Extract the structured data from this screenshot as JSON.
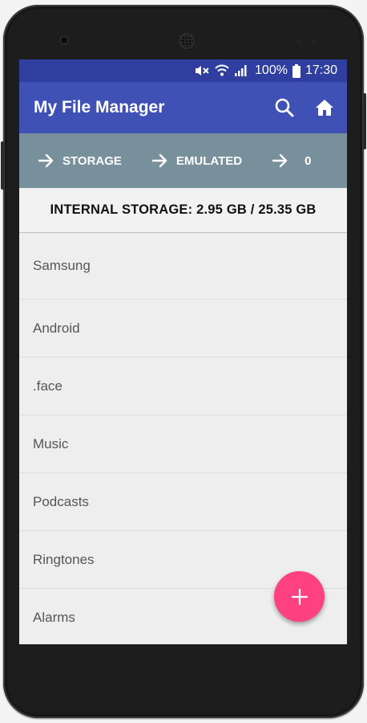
{
  "statusbar": {
    "battery_pct": "100%",
    "time": "17:30",
    "icons": [
      "mute-icon",
      "wifi-icon",
      "signal-icon",
      "battery-icon"
    ]
  },
  "appbar": {
    "title": "My File Manager",
    "search_icon": "search-icon",
    "home_icon": "home-icon"
  },
  "breadcrumb": {
    "items": [
      {
        "label": "STORAGE"
      },
      {
        "label": "EMULATED"
      },
      {
        "label": "0"
      }
    ]
  },
  "storage_info": "INTERNAL STORAGE: 2.95 GB / 25.35 GB",
  "files": [
    {
      "name": "Samsung"
    },
    {
      "name": "Android"
    },
    {
      "name": ".face"
    },
    {
      "name": "Music"
    },
    {
      "name": "Podcasts"
    },
    {
      "name": "Ringtones"
    },
    {
      "name": "Alarms"
    }
  ],
  "fab": {
    "icon": "plus-icon"
  },
  "colors": {
    "statusbar": "#303f9f",
    "appbar": "#3f51b5",
    "breadcrumb": "#78909c",
    "fab": "#ff4081",
    "list_bg": "#eeeeee"
  }
}
